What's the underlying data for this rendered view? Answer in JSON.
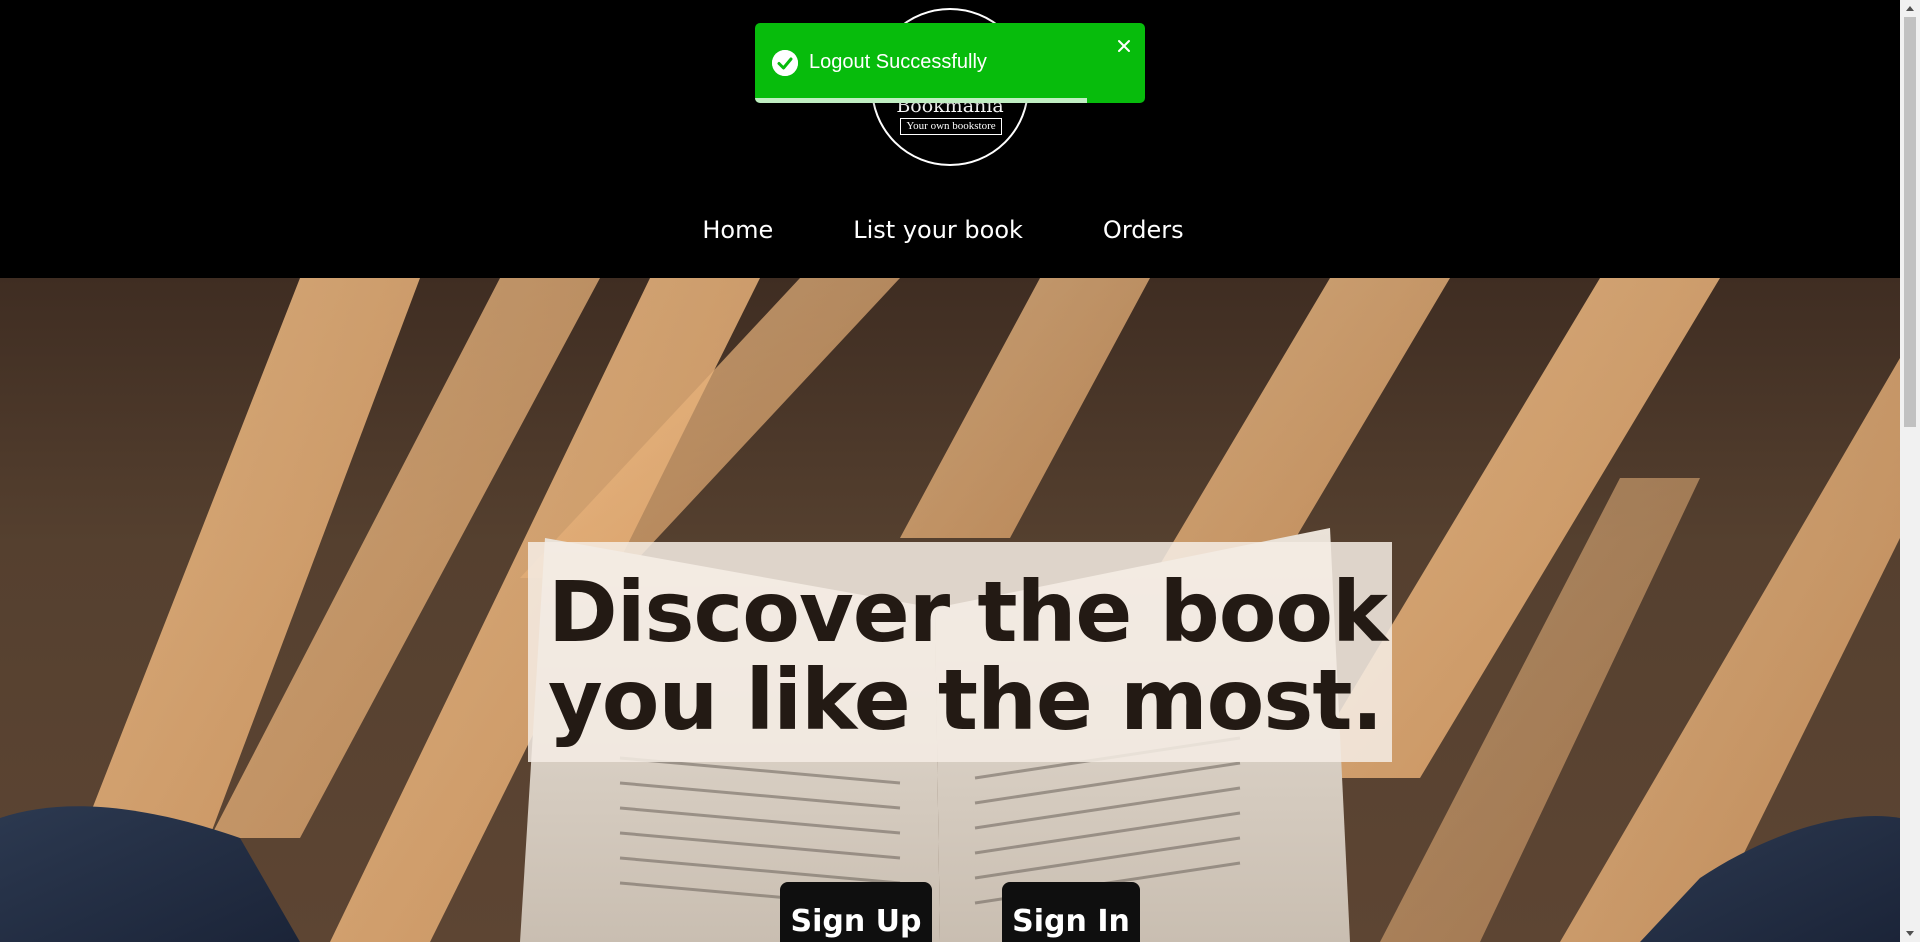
{
  "header": {
    "logo_title": "Bookmania",
    "logo_subtitle": "Your own bookstore",
    "nav": [
      {
        "label": "Home"
      },
      {
        "label": "List your book"
      },
      {
        "label": "Orders"
      }
    ]
  },
  "toast": {
    "message": "Logout Successfully",
    "type": "success",
    "icon": "check-circle-icon",
    "progress": 0.85,
    "color": "#07bc0c"
  },
  "hero": {
    "title_line1": "Discover the book",
    "title_line2": "you like the most.",
    "buttons": {
      "signup": "Sign Up",
      "signin": "Sign In"
    }
  },
  "colors": {
    "header_bg": "#000000",
    "title_box": "#f4ece4",
    "button_bg": "#0f0f0f"
  }
}
